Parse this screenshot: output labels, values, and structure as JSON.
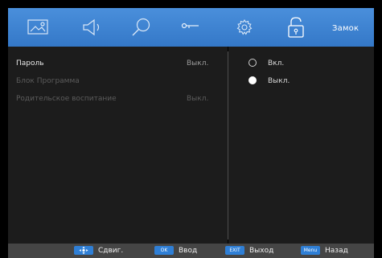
{
  "top_bar": {
    "tabs": [
      {
        "icon": "picture-icon"
      },
      {
        "icon": "sound-icon"
      },
      {
        "icon": "search-icon"
      },
      {
        "icon": "key-icon"
      },
      {
        "icon": "gear-icon"
      },
      {
        "icon": "lock-icon",
        "selected": true
      }
    ],
    "active_tab_label": "Замок"
  },
  "menu": {
    "items": [
      {
        "label": "Пароль",
        "value": "Выкл.",
        "state": "active"
      },
      {
        "label": "Блок Программа",
        "value": "",
        "state": "disabled"
      },
      {
        "label": "Родительское воспитание",
        "value": "Выкл.",
        "state": "disabled"
      }
    ]
  },
  "options": {
    "items": [
      {
        "label": "Вкл.",
        "selected": false
      },
      {
        "label": "Выкл.",
        "selected": true
      }
    ]
  },
  "bottom_bar": {
    "hints": [
      {
        "key": "",
        "key_icon": "move-arrows-icon",
        "label": "Сдвиг."
      },
      {
        "key": "OK",
        "label": "Ввод"
      },
      {
        "key": "EXIT",
        "label": "Выход"
      },
      {
        "key": "Menu",
        "label": "Назад"
      }
    ]
  },
  "colors": {
    "accent": "#3d83d0",
    "panel": "#1c1c1c",
    "bottom_bar": "#454545"
  }
}
